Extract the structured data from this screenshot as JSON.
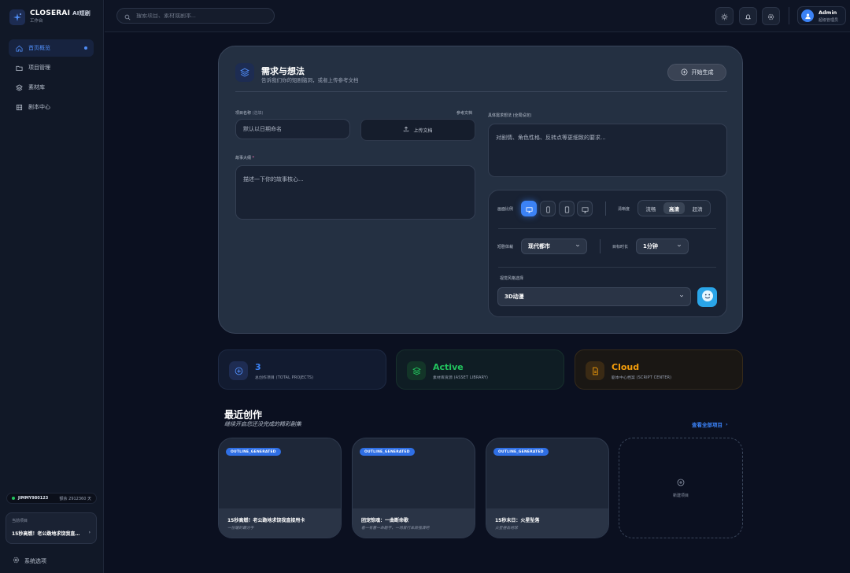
{
  "brand": {
    "name": "CLOSERAI",
    "ai_tag": "AI短剧",
    "subtitle": "工作台"
  },
  "sidebar": {
    "items": [
      {
        "label": "首页概览",
        "icon": "home-icon",
        "active": true
      },
      {
        "label": "项目管理",
        "icon": "folder-icon",
        "active": false
      },
      {
        "label": "素材库",
        "icon": "layers-icon",
        "active": false
      },
      {
        "label": "剧本中心",
        "icon": "film-icon",
        "active": false
      }
    ],
    "status": {
      "user_id": "JIMMY980123",
      "balance": "额余 2912360 天"
    },
    "current_project": {
      "label": "当前项目",
      "title": "15秒高燃！老公跪地求饶我直接甩卡"
    },
    "settings_label": "系统选项"
  },
  "topbar": {
    "search_placeholder": "搜索项目、素材或剧本...",
    "user": {
      "name": "Admin",
      "role": "超级管理员"
    }
  },
  "form": {
    "title": "需求与想法",
    "subtitle": "告诉我们你的短剧脑洞，或者上传参考文档",
    "generate_label": "开始生成",
    "project_name_label": "项目名称",
    "project_name_hint": "(选填)",
    "project_name_placeholder": "默认以日期命名",
    "reference_label": "参考文档",
    "upload_label": "上传文档",
    "detail_label": "具体需求想法 (全局设定)",
    "detail_placeholder": "对剧情、角色性格、反转点等更细致的要求...",
    "outline_label": "故事大纲",
    "outline_required": "*",
    "outline_placeholder": "描述一下你的故事核心..."
  },
  "options": {
    "ratio_label": "画面比例",
    "quality_label": "清晰度",
    "quality_options": [
      "流畅",
      "高清",
      "超清"
    ],
    "quality_selected": "高清",
    "genre_label": "短剧体裁",
    "genre_value": "现代都市",
    "duration_label": "目标时长",
    "duration_value": "1分钟",
    "style_label": "视觉风格选择",
    "style_value": "3D动漫"
  },
  "stats": [
    {
      "value": "3",
      "caption": "总创作项目 (TOTAL PROJECTS)",
      "color": "#3b82f6"
    },
    {
      "value": "Active",
      "caption": "素材库资源 (ASSET LIBRARY)",
      "color": "#22c55e"
    },
    {
      "value": "Cloud",
      "caption": "剧本中心档案 (SCRIPT CENTER)",
      "color": "#f59e0b"
    }
  ],
  "recent": {
    "title": "最近创作",
    "subtitle": "继续开启您还没完成的精彩剧集",
    "view_all": "查看全部项目",
    "projects": [
      {
        "status": "OUTLINE_GENERATED",
        "title": "15秒高燃！老公跪地求饶我直接甩卡",
        "desc": "一份暖的霸分手"
      },
      {
        "status": "OUTLINE_GENERATED",
        "title": "团宠惊魂：一曲断命歌",
        "desc": "看一有害一命题字，一场冒行牟腐强演吧"
      },
      {
        "status": "OUTLINE_GENERATED",
        "title": "15秒末日：火星坠落",
        "desc": "火星撞击地球"
      }
    ],
    "new_label": "新建项目"
  }
}
